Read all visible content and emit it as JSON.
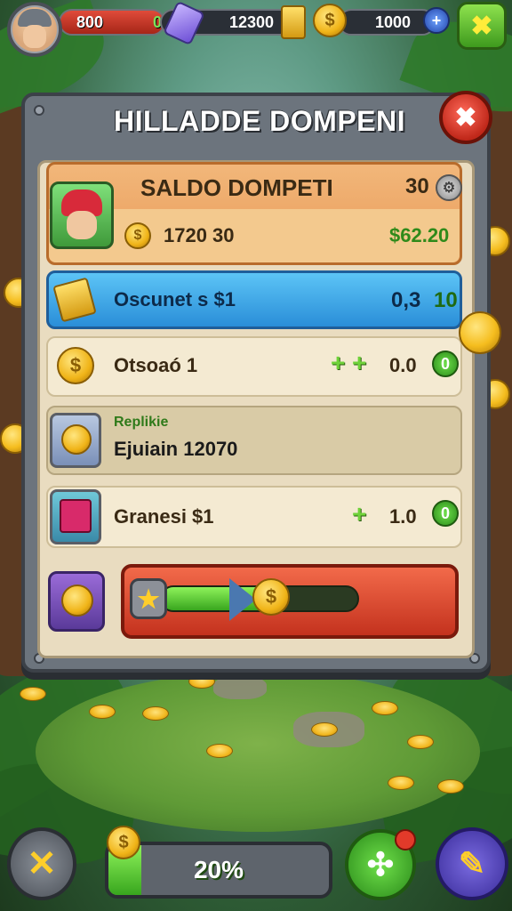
{
  "hud": {
    "health_value": "800",
    "health_extra": "0",
    "gems_value": "12300",
    "coins_value": "1000",
    "coin_glyph": "$",
    "plus_glyph": "+",
    "close_glyph": "✖"
  },
  "panel": {
    "title": "HILLADDE DOMPENI",
    "close_glyph": "✖",
    "balance": {
      "label": "SALDO DOMPETI",
      "badge": "30",
      "coins": "1720 30",
      "money": "$62.20"
    },
    "discount": {
      "label": "Oscunet s $1",
      "value_a": "0,3",
      "value_b": "10"
    },
    "stored": {
      "label": "Otsoaó 1",
      "value": "0.0",
      "badge": "0"
    },
    "replica": {
      "title": "Replikie",
      "subtitle": "Ejuiain 12070"
    },
    "gains": {
      "label": "Granesi $1",
      "value": "1.0",
      "badge": "0"
    },
    "progress": {
      "fraction": 0.55,
      "star_glyph": "★"
    }
  },
  "bottom": {
    "progress_label": "20%",
    "progress_fraction": 0.15,
    "left_glyph": "✕",
    "green_glyph": "✣",
    "purple_glyph": "✎"
  },
  "colors": {
    "accent_green": "#38a61e",
    "accent_red": "#c4321e",
    "accent_blue": "#2a8ed8",
    "gold": "#f0b418"
  },
  "icons": [
    "avatar-icon",
    "gem-icon",
    "gold-bar-icon",
    "coin-icon",
    "blue-gem-icon",
    "close-icon",
    "character-icon",
    "star-icon",
    "coins-stack-icon",
    "card-icon",
    "crossed-swords-icon",
    "gift-icon",
    "pencil-icon"
  ]
}
